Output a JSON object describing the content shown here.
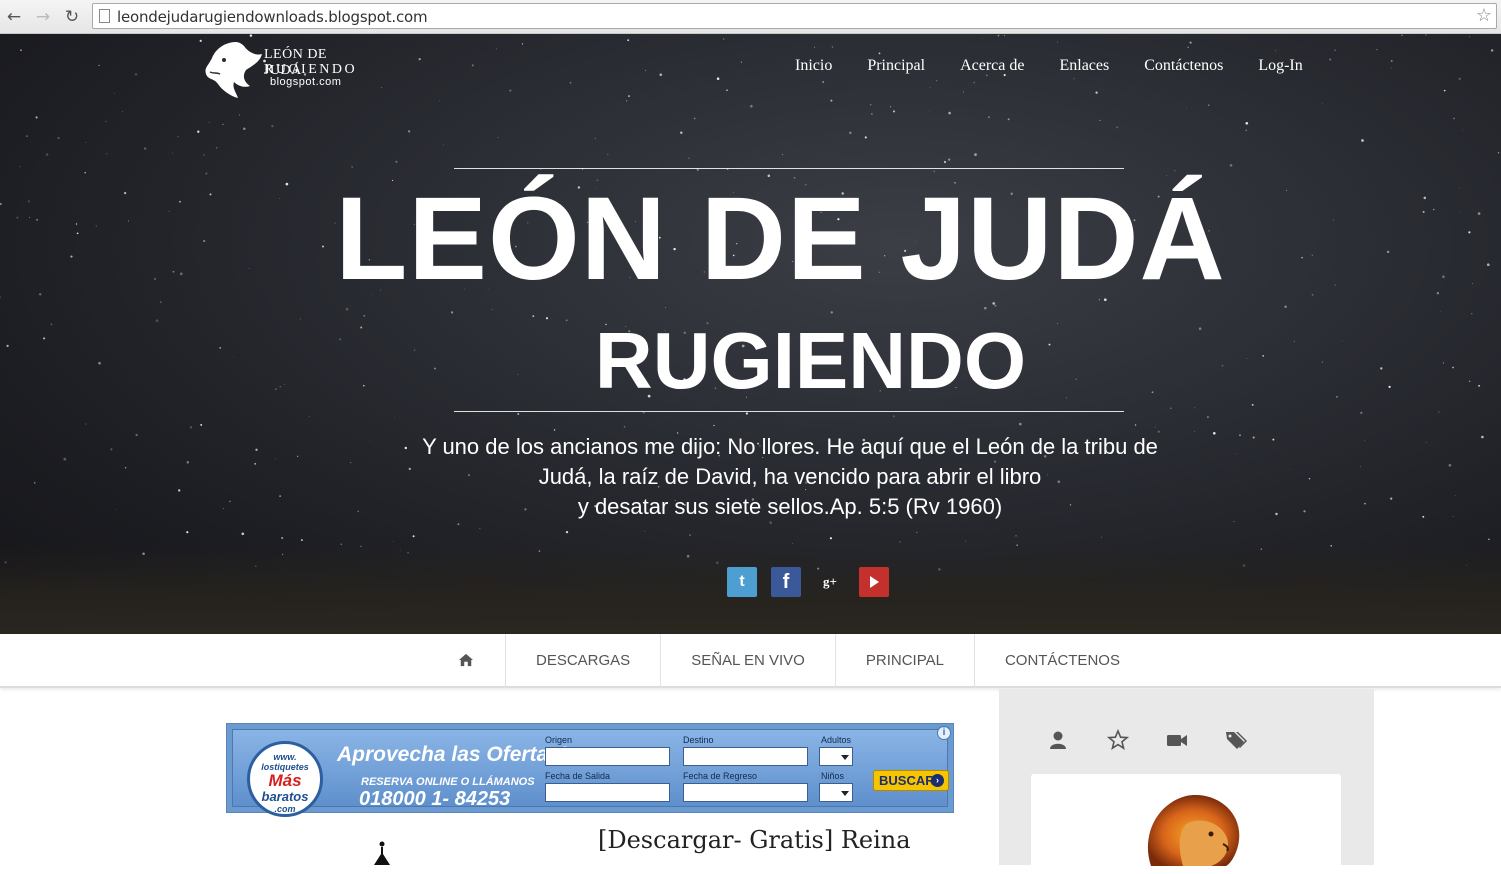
{
  "browser": {
    "url": "leondejudarugiendownloads.blogspot.com"
  },
  "logo": {
    "line1": "LEÓN DE JUDÁ",
    "line2": "RUGIENDO",
    "line3": "blogspot.com"
  },
  "topnav": {
    "items": [
      "Inicio",
      "Principal",
      "Acerca de",
      "Enlaces",
      "Contáctenos",
      "Log-In"
    ]
  },
  "hero": {
    "title": "LEÓN DE JUDÁ",
    "subtitle": "RUGIENDO",
    "quote_line1": "Y uno de los ancianos me dijo: No llores. He aquí que el León de la tribu de",
    "quote_line2": "Judá, la raíz de David, ha vencido para abrir el libro",
    "quote_line3": "y desatar sus siete sellos.Ap. 5:5 (Rv 1960)"
  },
  "social": {
    "icons": [
      "twitter-icon",
      "facebook-icon",
      "google-plus-icon",
      "youtube-icon"
    ],
    "twitter_glyph": "t",
    "facebook_glyph": "f",
    "gplus_glyph": "g+"
  },
  "subnav": {
    "items": [
      "DESCARGAS",
      "SEÑAL EN VIVO",
      "PRINCIPAL",
      "CONTÁCTENOS"
    ]
  },
  "ad": {
    "circle_top": "www.",
    "circle_mid": "lostiquetes",
    "circle_mas": "Más",
    "circle_bottom": "baratos",
    "circle_com": ".com",
    "headline": "Aprovecha las Ofertas!",
    "sub": "RESERVA ONLINE O LLÁMANOS",
    "phone": "018000 1- 84253",
    "label_origen": "Origen",
    "label_destino": "Destino",
    "label_adultos": "Adultos",
    "label_salida": "Fecha de Salida",
    "label_regreso": "Fecha de Regreso",
    "label_ninos": "Niños",
    "button": "BUSCAR",
    "button_arrow": "›",
    "info": "i"
  },
  "post": {
    "title": "[Descargar- Gratis] Reina"
  },
  "colors": {
    "twitter": "#4d9fd1",
    "facebook": "#3b5998",
    "youtube": "#c4302b",
    "sidebar_bg": "#e9e9e9"
  }
}
